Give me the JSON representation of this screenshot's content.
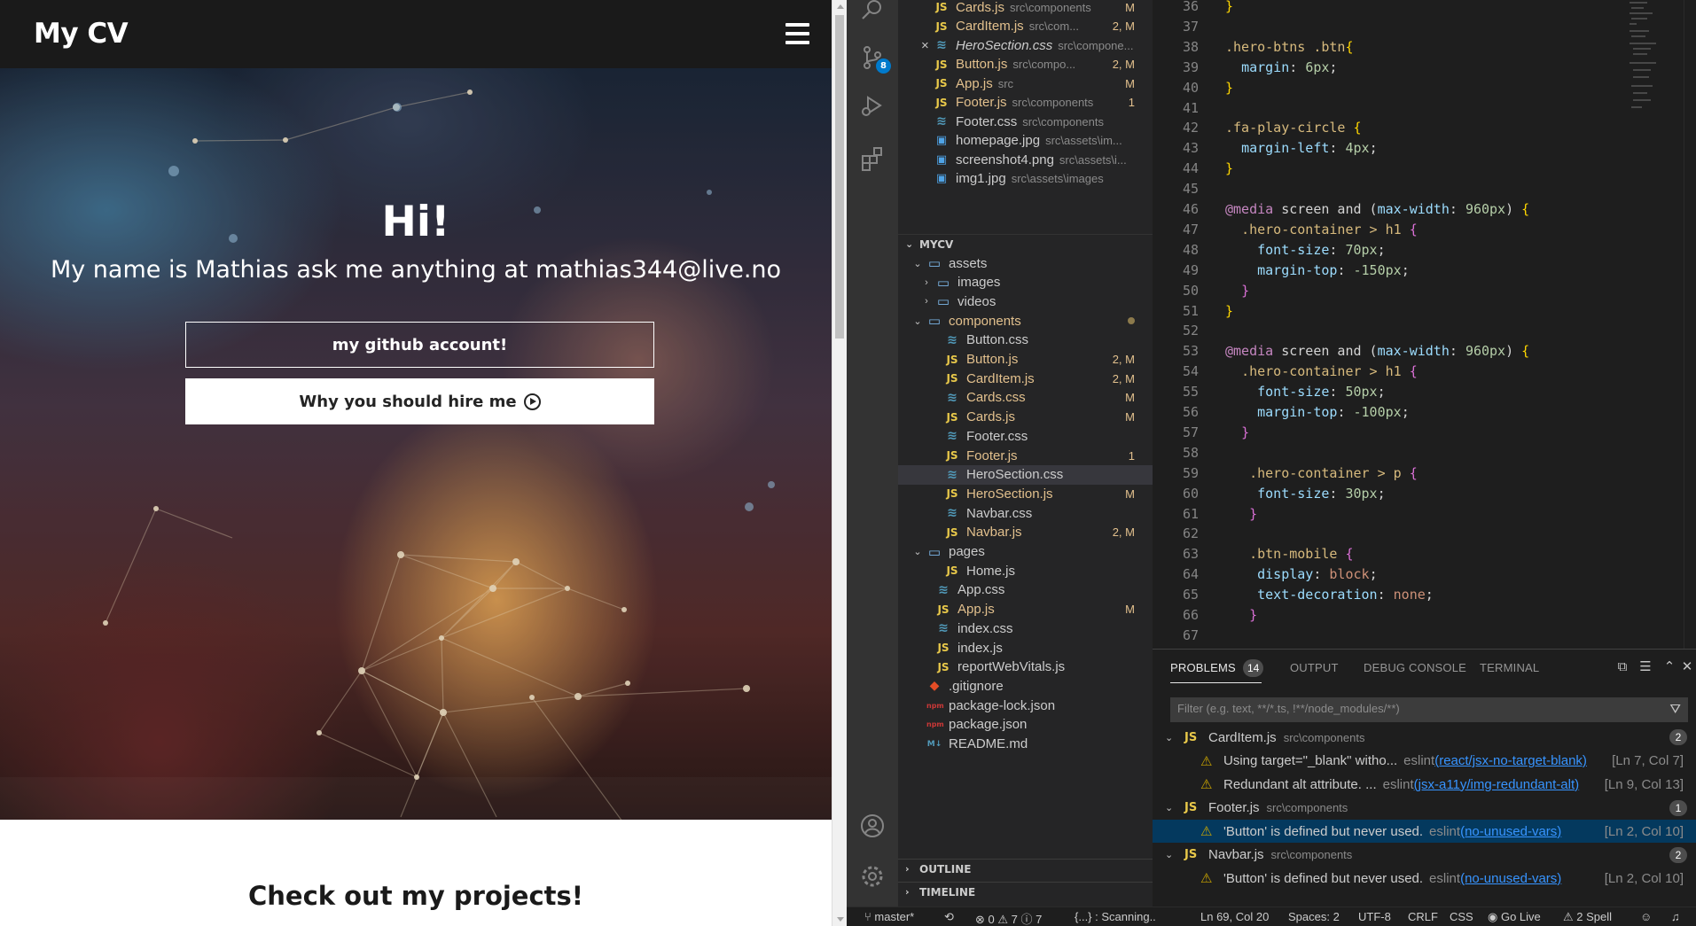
{
  "preview": {
    "logo": "My CV",
    "hero": {
      "title": "Hi!",
      "subtitle": "My name is Mathias ask me anything at mathias344@live.no",
      "btn_github": "my github account!",
      "btn_hire": "Why you should hire me"
    },
    "projects_title": "Check out my projects!"
  },
  "activity_bar": {
    "items": [
      "search-icon",
      "source-control-icon",
      "run-debug-icon",
      "extensions-icon",
      "account-icon",
      "settings-gear-icon"
    ],
    "scm_badge": "8"
  },
  "explorer": {
    "open_editors": [
      {
        "icon": "JS",
        "name": "Cards.js",
        "path": "src\\components",
        "status": "M"
      },
      {
        "icon": "JS",
        "name": "CardItem.js",
        "path": "src\\com...",
        "status": "2, M"
      },
      {
        "icon": "css",
        "name": "HeroSection.css",
        "path": "src\\compone...",
        "status": "",
        "close": "×"
      },
      {
        "icon": "JS",
        "name": "Button.js",
        "path": "src\\compo...",
        "status": "2, M"
      },
      {
        "icon": "JS",
        "name": "App.js",
        "path": "src",
        "status": "M"
      },
      {
        "icon": "JS",
        "name": "Footer.js",
        "path": "src\\components",
        "status": "1"
      },
      {
        "icon": "css",
        "name": "Footer.css",
        "path": "src\\components",
        "status": ""
      },
      {
        "icon": "img",
        "name": "homepage.jpg",
        "path": "src\\assets\\im...",
        "status": ""
      },
      {
        "icon": "img",
        "name": "screenshot4.png",
        "path": "src\\assets\\i...",
        "status": ""
      },
      {
        "icon": "img",
        "name": "img1.jpg",
        "path": "src\\assets\\images",
        "status": ""
      }
    ],
    "project_title": "MYCV",
    "tree": [
      {
        "indent": 1,
        "chev": "v",
        "icon": "folder",
        "name": "assets"
      },
      {
        "indent": 2,
        "chev": ">",
        "icon": "folder",
        "name": "images"
      },
      {
        "indent": 2,
        "chev": ">",
        "icon": "folder",
        "name": "videos"
      },
      {
        "indent": 1,
        "chev": "v",
        "icon": "folder",
        "name": "components",
        "mod": true,
        "dot": true
      },
      {
        "indent": 3,
        "icon": "css",
        "name": "Button.css"
      },
      {
        "indent": 3,
        "icon": "JS",
        "name": "Button.js",
        "mod": true,
        "status": "2, M"
      },
      {
        "indent": 3,
        "icon": "JS",
        "name": "CardItem.js",
        "mod": true,
        "status": "2, M"
      },
      {
        "indent": 3,
        "icon": "css",
        "name": "Cards.css",
        "mod": true,
        "status": "M"
      },
      {
        "indent": 3,
        "icon": "JS",
        "name": "Cards.js",
        "mod": true,
        "status": "M"
      },
      {
        "indent": 3,
        "icon": "css",
        "name": "Footer.css"
      },
      {
        "indent": 3,
        "icon": "JS",
        "name": "Footer.js",
        "mod": true,
        "status": "1"
      },
      {
        "indent": 3,
        "icon": "css",
        "name": "HeroSection.css",
        "selected": true
      },
      {
        "indent": 3,
        "icon": "JS",
        "name": "HeroSection.js",
        "mod": true,
        "status": "M"
      },
      {
        "indent": 3,
        "icon": "css",
        "name": "Navbar.css"
      },
      {
        "indent": 3,
        "icon": "JS",
        "name": "Navbar.js",
        "mod": true,
        "status": "2, M"
      },
      {
        "indent": 1,
        "chev": "v",
        "icon": "folder",
        "name": "pages"
      },
      {
        "indent": 3,
        "icon": "JS",
        "name": "Home.js"
      },
      {
        "indent": 2,
        "icon": "css",
        "name": "App.css"
      },
      {
        "indent": 2,
        "icon": "JS",
        "name": "App.js",
        "mod": true,
        "status": "M"
      },
      {
        "indent": 2,
        "icon": "css",
        "name": "index.css"
      },
      {
        "indent": 2,
        "icon": "JS",
        "name": "index.js"
      },
      {
        "indent": 2,
        "icon": "JS",
        "name": "reportWebVitals.js"
      },
      {
        "indent": 1,
        "icon": "git",
        "name": ".gitignore"
      },
      {
        "indent": 1,
        "icon": "npm",
        "name": "package-lock.json"
      },
      {
        "indent": 1,
        "icon": "npm",
        "name": "package.json"
      },
      {
        "indent": 1,
        "icon": "md",
        "name": "README.md"
      }
    ],
    "outline": "OUTLINE",
    "timeline": "TIMELINE"
  },
  "editor": {
    "lines": [
      {
        "n": "36",
        "t": [
          [
            "br1",
            "}"
          ]
        ]
      },
      {
        "n": "37",
        "t": []
      },
      {
        "n": "38",
        "t": [
          [
            "sel",
            ".hero-btns .btn"
          ],
          [
            "br1",
            "{"
          ]
        ]
      },
      {
        "n": "39",
        "t": [
          [
            "plain",
            "  "
          ],
          [
            "prop",
            "margin"
          ],
          [
            "plain",
            ": "
          ],
          [
            "num",
            "6px"
          ],
          [
            "plain",
            ";"
          ]
        ]
      },
      {
        "n": "40",
        "t": [
          [
            "br1",
            "}"
          ]
        ]
      },
      {
        "n": "41",
        "t": []
      },
      {
        "n": "42",
        "t": [
          [
            "sel",
            ".fa-play-circle "
          ],
          [
            "br1",
            "{"
          ]
        ]
      },
      {
        "n": "43",
        "t": [
          [
            "plain",
            "  "
          ],
          [
            "prop",
            "margin-left"
          ],
          [
            "plain",
            ": "
          ],
          [
            "num",
            "4px"
          ],
          [
            "plain",
            ";"
          ]
        ]
      },
      {
        "n": "44",
        "t": [
          [
            "br1",
            "}"
          ]
        ]
      },
      {
        "n": "45",
        "t": []
      },
      {
        "n": "46",
        "t": [
          [
            "kw",
            "@media"
          ],
          [
            "plain",
            " screen and ("
          ],
          [
            "prop",
            "max-width"
          ],
          [
            "plain",
            ": "
          ],
          [
            "num",
            "960px"
          ],
          [
            "plain",
            ") "
          ],
          [
            "br1",
            "{"
          ]
        ]
      },
      {
        "n": "47",
        "t": [
          [
            "plain",
            "  "
          ],
          [
            "sel",
            ".hero-container > h1 "
          ],
          [
            "br2",
            "{"
          ]
        ]
      },
      {
        "n": "48",
        "t": [
          [
            "plain",
            "    "
          ],
          [
            "prop",
            "font-size"
          ],
          [
            "plain",
            ": "
          ],
          [
            "num",
            "70px"
          ],
          [
            "plain",
            ";"
          ]
        ]
      },
      {
        "n": "49",
        "t": [
          [
            "plain",
            "    "
          ],
          [
            "prop",
            "margin-top"
          ],
          [
            "plain",
            ": "
          ],
          [
            "num",
            "-150px"
          ],
          [
            "plain",
            ";"
          ]
        ]
      },
      {
        "n": "50",
        "t": [
          [
            "plain",
            "  "
          ],
          [
            "br2",
            "}"
          ]
        ]
      },
      {
        "n": "51",
        "t": [
          [
            "br1",
            "}"
          ]
        ]
      },
      {
        "n": "52",
        "t": []
      },
      {
        "n": "53",
        "t": [
          [
            "kw",
            "@media"
          ],
          [
            "plain",
            " screen and ("
          ],
          [
            "prop",
            "max-width"
          ],
          [
            "plain",
            ": "
          ],
          [
            "num",
            "960px"
          ],
          [
            "plain",
            ") "
          ],
          [
            "br1",
            "{"
          ]
        ]
      },
      {
        "n": "54",
        "t": [
          [
            "plain",
            "  "
          ],
          [
            "sel",
            ".hero-container > h1 "
          ],
          [
            "br2",
            "{"
          ]
        ]
      },
      {
        "n": "55",
        "t": [
          [
            "plain",
            "    "
          ],
          [
            "prop",
            "font-size"
          ],
          [
            "plain",
            ": "
          ],
          [
            "num",
            "50px"
          ],
          [
            "plain",
            ";"
          ]
        ]
      },
      {
        "n": "56",
        "t": [
          [
            "plain",
            "    "
          ],
          [
            "prop",
            "margin-top"
          ],
          [
            "plain",
            ": "
          ],
          [
            "num",
            "-100px"
          ],
          [
            "plain",
            ";"
          ]
        ]
      },
      {
        "n": "57",
        "t": [
          [
            "plain",
            "  "
          ],
          [
            "br2",
            "}"
          ]
        ]
      },
      {
        "n": "58",
        "t": []
      },
      {
        "n": "59",
        "t": [
          [
            "plain",
            "   "
          ],
          [
            "sel",
            ".hero-container > p "
          ],
          [
            "br2",
            "{"
          ]
        ]
      },
      {
        "n": "60",
        "t": [
          [
            "plain",
            "    "
          ],
          [
            "prop",
            "font-size"
          ],
          [
            "plain",
            ": "
          ],
          [
            "num",
            "30px"
          ],
          [
            "plain",
            ";"
          ]
        ]
      },
      {
        "n": "61",
        "t": [
          [
            "plain",
            "   "
          ],
          [
            "br2",
            "}"
          ]
        ]
      },
      {
        "n": "62",
        "t": []
      },
      {
        "n": "63",
        "t": [
          [
            "plain",
            "   "
          ],
          [
            "sel",
            ".btn-mobile "
          ],
          [
            "br2",
            "{"
          ]
        ]
      },
      {
        "n": "64",
        "t": [
          [
            "plain",
            "    "
          ],
          [
            "prop",
            "display"
          ],
          [
            "plain",
            ": "
          ],
          [
            "val",
            "block"
          ],
          [
            "plain",
            ";"
          ]
        ]
      },
      {
        "n": "65",
        "t": [
          [
            "plain",
            "    "
          ],
          [
            "prop",
            "text-decoration"
          ],
          [
            "plain",
            ": "
          ],
          [
            "val",
            "none"
          ],
          [
            "plain",
            ";"
          ]
        ]
      },
      {
        "n": "66",
        "t": [
          [
            "plain",
            "   "
          ],
          [
            "br2",
            "}"
          ]
        ]
      },
      {
        "n": "67",
        "t": []
      }
    ]
  },
  "panel": {
    "tabs": [
      "PROBLEMS",
      "OUTPUT",
      "DEBUG CONSOLE",
      "TERMINAL"
    ],
    "problem_count": "14",
    "filter_placeholder": "Filter (e.g. text, **/*.ts, !**/node_modules/**)",
    "groups": [
      {
        "file": "CardItem.js",
        "path": "src\\components",
        "count": "2",
        "items": [
          {
            "msg": "Using target=\"_blank\" witho...",
            "src": "eslint",
            "rule": "(react/jsx-no-target-blank)",
            "loc": "[Ln 7, Col 7]"
          },
          {
            "msg": "Redundant alt attribute. ...",
            "src": "eslint",
            "rule": "(jsx-a11y/img-redundant-alt)",
            "loc": "[Ln 9, Col 13]"
          }
        ]
      },
      {
        "file": "Footer.js",
        "path": "src\\components",
        "count": "1",
        "items": [
          {
            "msg": "'Button' is defined but never used.",
            "src": "eslint",
            "rule": "(no-unused-vars)",
            "loc": "[Ln 2, Col 10]",
            "selected": true
          }
        ]
      },
      {
        "file": "Navbar.js",
        "path": "src\\components",
        "count": "2",
        "items": [
          {
            "msg": "'Button' is defined but never used.",
            "src": "eslint",
            "rule": "(no-unused-vars)",
            "loc": "[Ln 2, Col 10]"
          }
        ]
      }
    ]
  },
  "statusbar": {
    "branch": "master*",
    "errors": "0",
    "warnings": "7",
    "infos": "7",
    "scanning": "{...} : Scanning..",
    "cursor": "Ln 69, Col 20",
    "spaces": "Spaces: 2",
    "encoding": "UTF-8",
    "eol": "CRLF",
    "language": "CSS",
    "golive": "Go Live",
    "spell": "2 Spell"
  }
}
